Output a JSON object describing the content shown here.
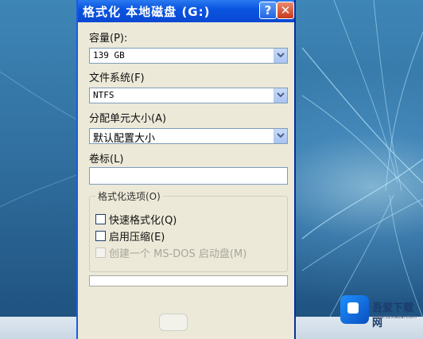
{
  "window": {
    "title": "格式化 本地磁盘 (G:)",
    "help_label": "?",
    "close_label": "✕"
  },
  "capacity": {
    "label": "容量(P):",
    "value": "139 GB"
  },
  "file_system": {
    "label": "文件系统(F)",
    "value": "NTFS"
  },
  "allocation_unit": {
    "label": "分配单元大小(A)",
    "value": "默认配置大小"
  },
  "volume_label": {
    "label": "卷标(L)",
    "value": ""
  },
  "format_options": {
    "title": "格式化选项(O)",
    "quick_format": {
      "label": "快速格式化(Q)",
      "checked": false
    },
    "enable_compression": {
      "label": "启用压缩(E)",
      "checked": false
    },
    "ms_dos_startup": {
      "label": "创建一个 MS-DOS 启动盘(M)",
      "checked": false,
      "enabled": false
    }
  },
  "progress": 0,
  "watermark": {
    "name": "吾爱下载网",
    "url": "www.52xiazai.com"
  },
  "colors": {
    "titlebar": "#0a55e0",
    "dialog_bg": "#ece9d8",
    "desktop": "#2f6d9d"
  }
}
